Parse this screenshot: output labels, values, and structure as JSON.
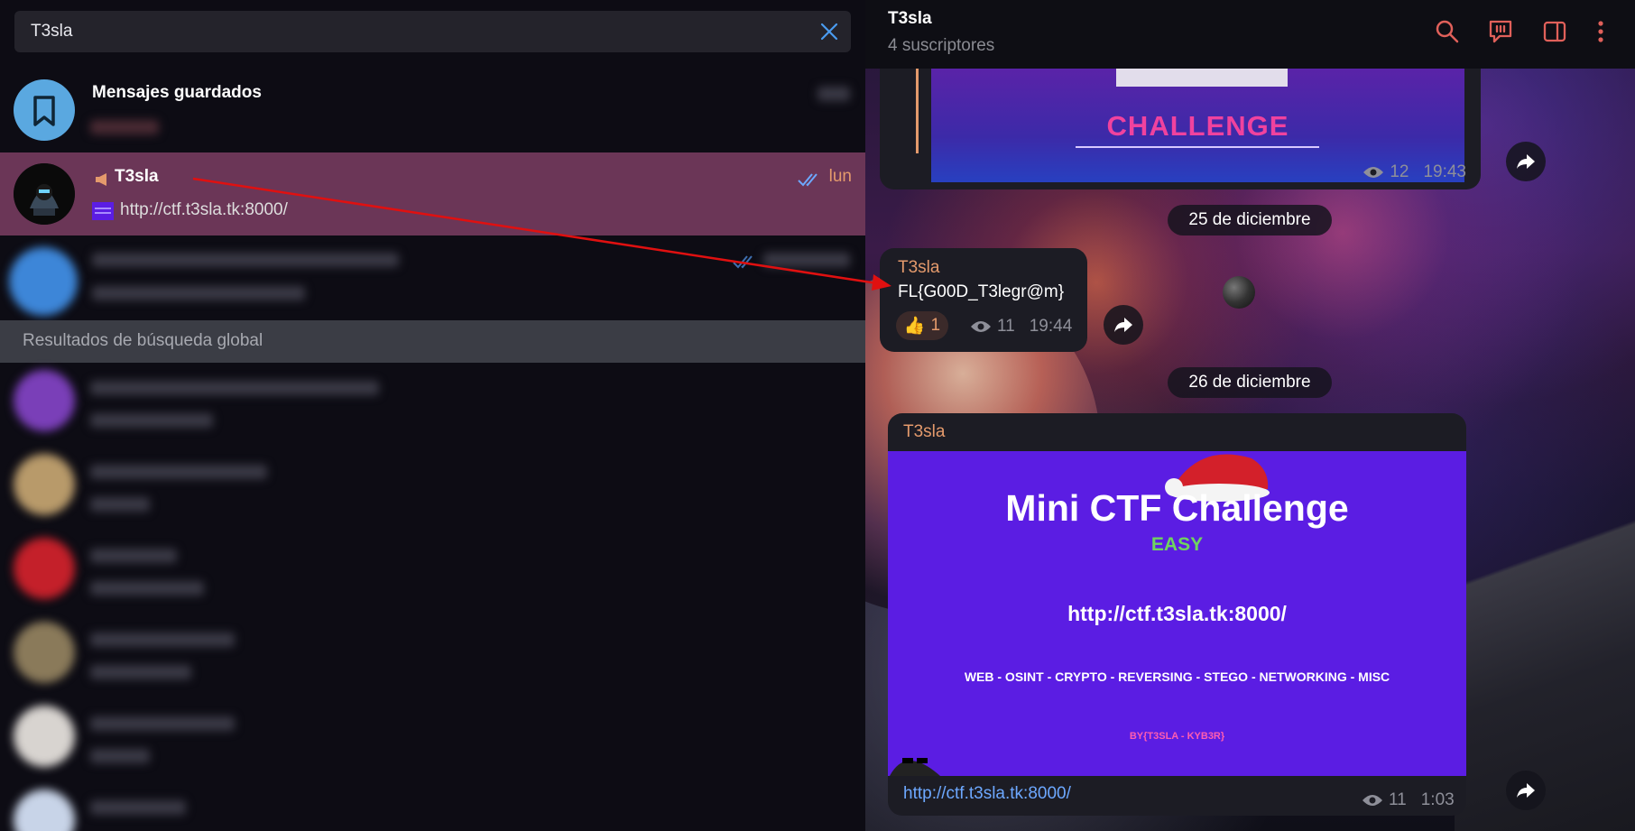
{
  "search": {
    "value": "T3sla"
  },
  "chats": {
    "saved": {
      "title": "Mensajes guardados"
    },
    "t3sla": {
      "title": "T3sla",
      "preview": "http://ctf.t3sla.tk:8000/",
      "time": "lun"
    }
  },
  "global_results": {
    "header": "Resultados de búsqueda global"
  },
  "channel": {
    "title": "T3sla",
    "subscribers": "4 suscriptores"
  },
  "messages": {
    "first": {
      "banner_text": "CHALLENGE",
      "views": "12",
      "time": "19:43"
    },
    "date1": "25 de diciembre",
    "flag": {
      "author": "T3sla",
      "text": "FL{G00D_T3legr@m}",
      "reaction": "👍",
      "reaction_count": "1",
      "views": "11",
      "time": "19:44"
    },
    "date2": "26 de diciembre",
    "ctf": {
      "author": "T3sla",
      "title": "Mini CTF Challenge",
      "level": "EASY",
      "url": "http://ctf.t3sla.tk:8000/",
      "categories": "WEB - OSINT - CRYPTO - REVERSING - STEGO - NETWORKING - MISC",
      "by": "BY{T3SLA - KYB3R}",
      "link": "http://ctf.t3sla.tk:8000/",
      "views": "11",
      "time": "1:03"
    }
  },
  "colors": {
    "accent": "#e49a6c",
    "selected_row": "#6b3657",
    "link": "#6da8ff",
    "banner": "#5b1de3",
    "arrow": "#e01010"
  }
}
